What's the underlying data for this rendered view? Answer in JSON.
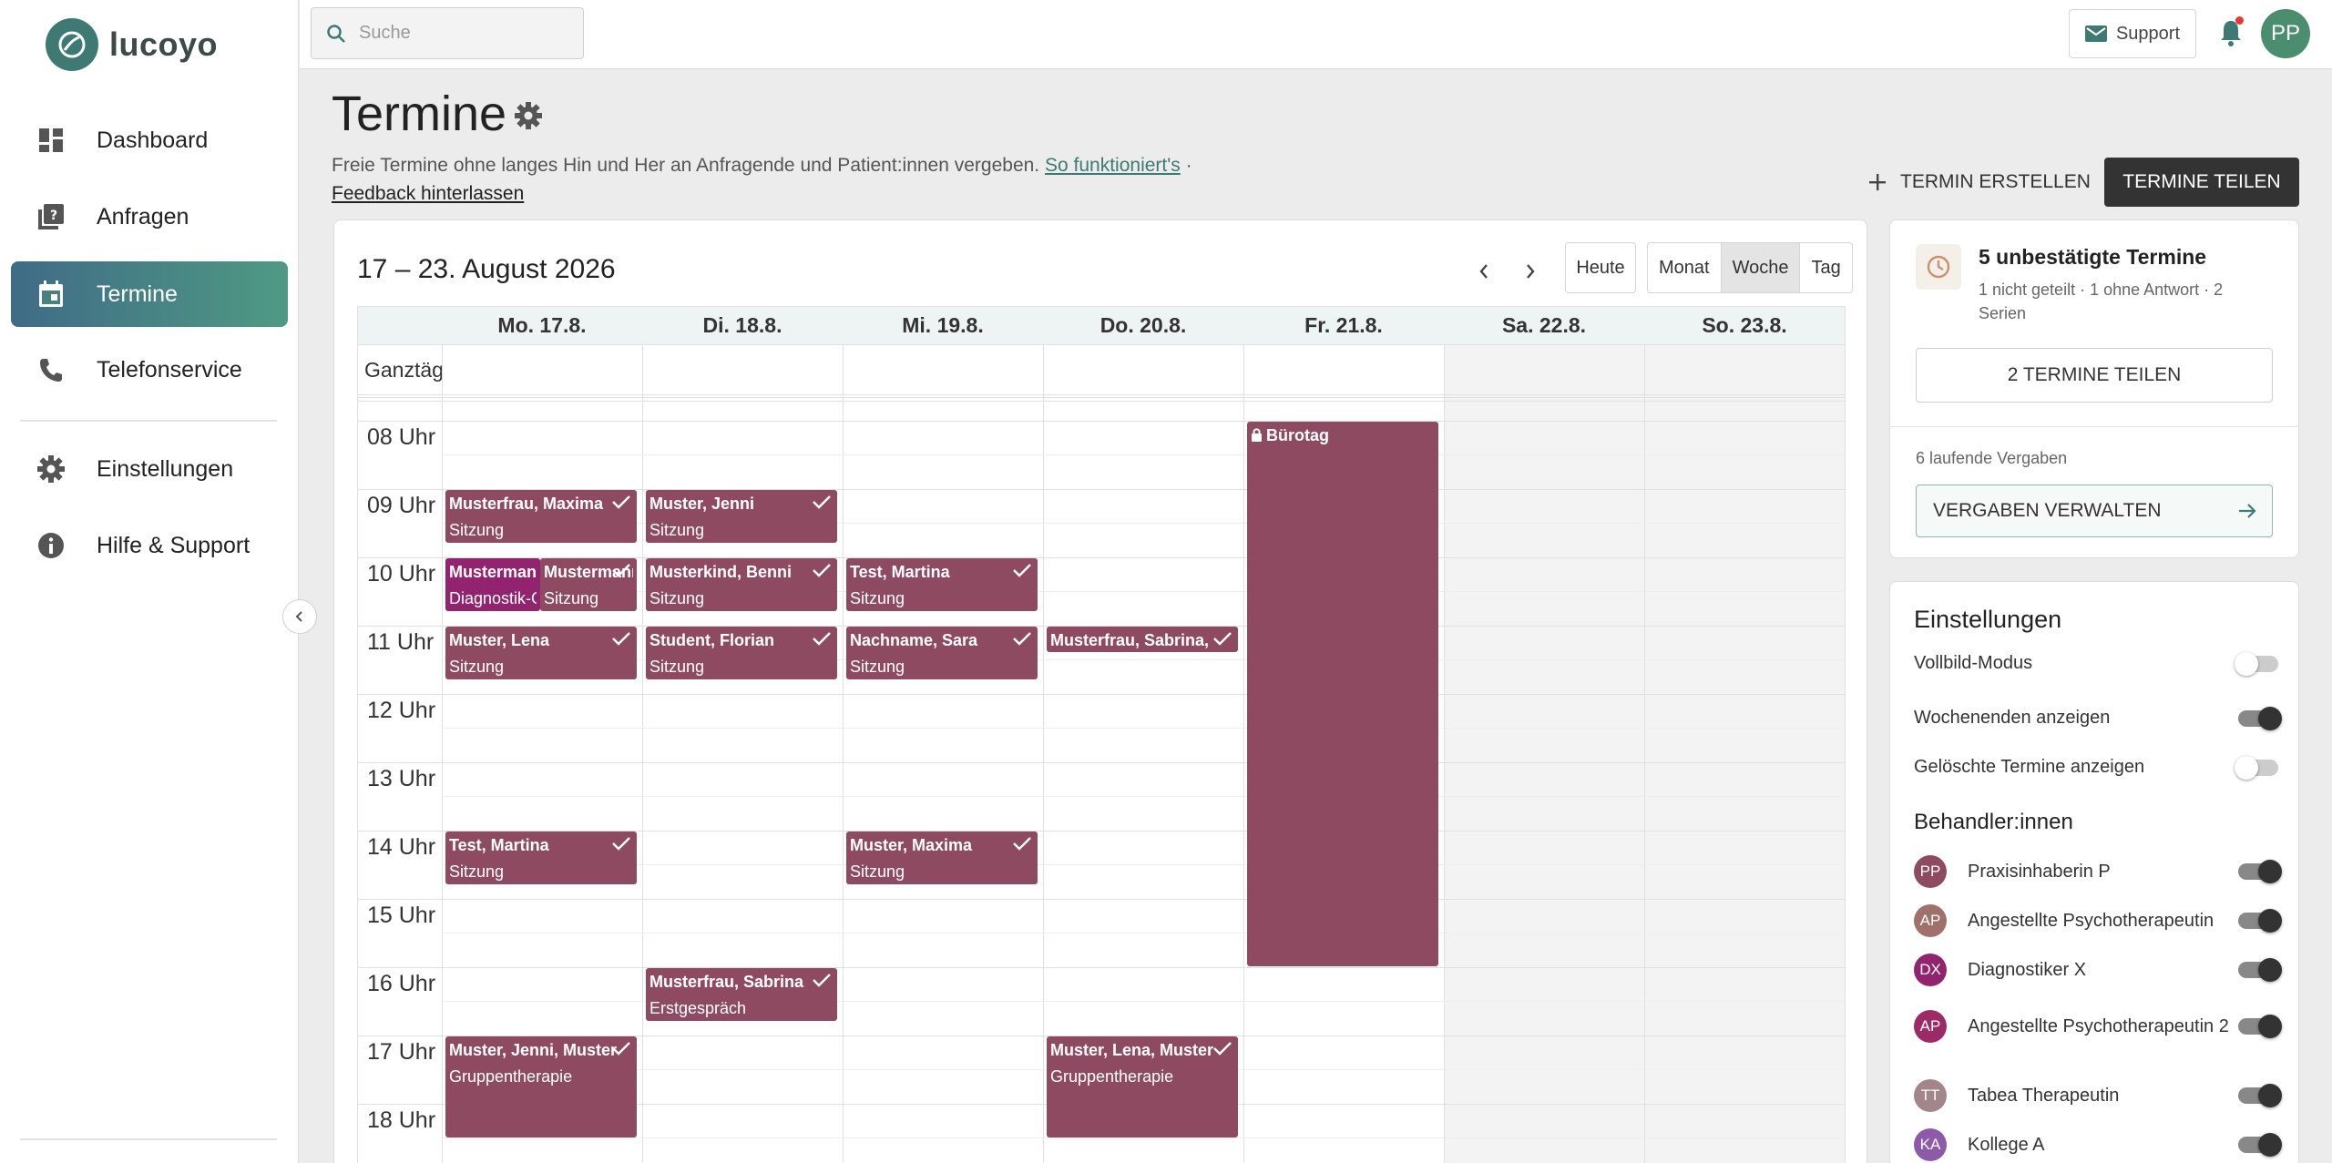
{
  "app": {
    "name": "lucoyo"
  },
  "sidebar": {
    "items": [
      {
        "label": "Dashboard",
        "icon": "dashboard-icon"
      },
      {
        "label": "Anfragen",
        "icon": "requests-icon"
      },
      {
        "label": "Termine",
        "icon": "calendar-icon",
        "active": true
      },
      {
        "label": "Telefonservice",
        "icon": "phone-icon"
      },
      {
        "label": "Einstellungen",
        "icon": "gear-icon"
      },
      {
        "label": "Hilfe & Support",
        "icon": "info-icon"
      }
    ]
  },
  "topbar": {
    "search_placeholder": "Suche",
    "support_label": "Support",
    "user_initials": "PP"
  },
  "page": {
    "title": "Termine",
    "description": "Freie Termine ohne langes Hin und Her an Anfragende und Patient:innen vergeben.",
    "link_label": "So funktioniert's",
    "separator": " ·",
    "feedback_label": "Feedback hinterlassen",
    "create_label": "TERMIN ERSTELLEN",
    "share_label": "TERMINE TEILEN"
  },
  "calendar": {
    "range": "17 – 23. August 2026",
    "today_label": "Heute",
    "views": [
      "Monat",
      "Woche",
      "Tag"
    ],
    "selected_view": "Woche",
    "allday_label": "Ganztägig",
    "days": [
      {
        "label": "Mo. 17.8.",
        "weekend": false
      },
      {
        "label": "Di. 18.8.",
        "weekend": false
      },
      {
        "label": "Mi. 19.8.",
        "weekend": false
      },
      {
        "label": "Do. 20.8.",
        "weekend": false
      },
      {
        "label": "Fr. 21.8.",
        "weekend": false
      },
      {
        "label": "Sa. 22.8.",
        "weekend": true
      },
      {
        "label": "So. 23.8.",
        "weekend": true
      }
    ],
    "hours": [
      "08 Uhr",
      "09 Uhr",
      "10 Uhr",
      "11 Uhr",
      "12 Uhr",
      "13 Uhr",
      "14 Uhr",
      "15 Uhr",
      "16 Uhr",
      "17 Uhr",
      "18 Uhr"
    ],
    "events": [
      {
        "day": 0,
        "start": 9,
        "end": 9.8,
        "name": "Musterfrau, Maxima",
        "type": "Sitzung",
        "confirmed": true
      },
      {
        "day": 0,
        "start": 10,
        "end": 10.8,
        "name": "Mustermann",
        "type": "Diagnostik-Gespräch",
        "confirmed": false,
        "color": "dx",
        "lane": 0
      },
      {
        "day": 0,
        "start": 10,
        "end": 10.8,
        "name": "Mustermann",
        "type": "Sitzung",
        "confirmed": true,
        "lane": 1
      },
      {
        "day": 0,
        "start": 11,
        "end": 11.8,
        "name": "Muster, Lena",
        "type": "Sitzung",
        "confirmed": true
      },
      {
        "day": 0,
        "start": 14,
        "end": 14.8,
        "name": "Test, Martina",
        "type": "Sitzung",
        "confirmed": true
      },
      {
        "day": 0,
        "start": 17,
        "end": 18.5,
        "name": "Muster, Jenni, Muster",
        "type": "Gruppentherapie",
        "confirmed": true
      },
      {
        "day": 1,
        "start": 9,
        "end": 9.8,
        "name": "Muster, Jenni",
        "type": "Sitzung",
        "confirmed": true
      },
      {
        "day": 1,
        "start": 10,
        "end": 10.8,
        "name": "Musterkind, Benni",
        "type": "Sitzung",
        "confirmed": true
      },
      {
        "day": 1,
        "start": 11,
        "end": 11.8,
        "name": "Student, Florian",
        "type": "Sitzung",
        "confirmed": true
      },
      {
        "day": 1,
        "start": 16,
        "end": 16.8,
        "name": "Musterfrau, Sabrina",
        "type": "Erstgespräch",
        "confirmed": true
      },
      {
        "day": 2,
        "start": 10,
        "end": 10.8,
        "name": "Test, Martina",
        "type": "Sitzung",
        "confirmed": true
      },
      {
        "day": 2,
        "start": 11,
        "end": 11.8,
        "name": "Nachname, Sara",
        "type": "Sitzung",
        "confirmed": true
      },
      {
        "day": 2,
        "start": 14,
        "end": 14.8,
        "name": "Muster, Maxima",
        "type": "Sitzung",
        "confirmed": true
      },
      {
        "day": 3,
        "start": 11,
        "end": 11.4,
        "name": "Musterfrau, Sabrina,",
        "type": "",
        "confirmed": true
      },
      {
        "day": 3,
        "start": 17,
        "end": 18.5,
        "name": "Muster, Lena, Muster",
        "type": "Gruppentherapie",
        "confirmed": true
      },
      {
        "day": 4,
        "start": 8,
        "end": 16,
        "name": "Bürotag",
        "type": "",
        "confirmed": false,
        "locked": true
      }
    ]
  },
  "pending": {
    "title": "5 unbestätigte Termine",
    "subtitle": "1 nicht geteilt · 1 ohne Antwort · 2 Serien",
    "share_button": "2 TERMINE TEILEN",
    "running_label": "6 laufende Vergaben",
    "manage_button": "VERGABEN VERWALTEN"
  },
  "settings": {
    "title": "Einstellungen",
    "toggles": [
      {
        "label": "Vollbild-Modus",
        "on": false
      },
      {
        "label": "Wochenenden anzeigen",
        "on": true
      },
      {
        "label": "Gelöschte Termine anzeigen",
        "on": false
      }
    ],
    "practitioners_title": "Behandler:innen",
    "practitioners": [
      {
        "initials": "PP",
        "name": "Praxisinhaberin P",
        "color": "#8e4a61",
        "on": true
      },
      {
        "initials": "AP",
        "name": "Angestellte Psychotherapeutin",
        "color": "#a0716a",
        "on": true
      },
      {
        "initials": "DX",
        "name": "Diagnostiker X",
        "color": "#92236f",
        "on": true
      },
      {
        "initials": "AP",
        "name": "Angestellte Psychotherapeutin 2",
        "color": "#9c2a66",
        "on": true
      },
      {
        "initials": "TT",
        "name": "Tabea Therapeutin",
        "color": "#a3868a",
        "on": true
      },
      {
        "initials": "KA",
        "name": "Kollege A",
        "color": "#8c5aa8",
        "on": true
      }
    ]
  }
}
